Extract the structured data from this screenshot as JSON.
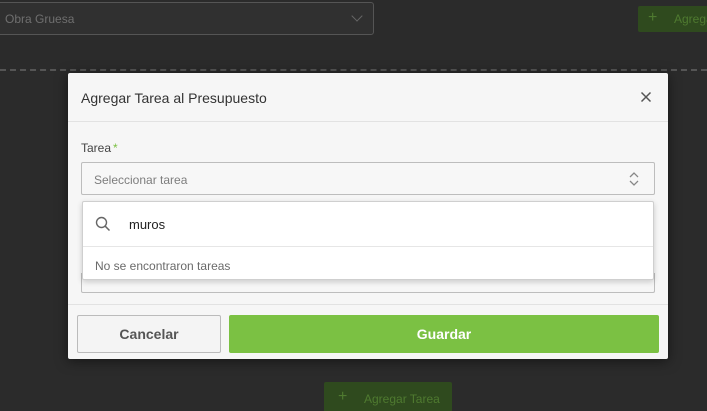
{
  "background": {
    "stage_select": {
      "value": "Obra Gruesa"
    },
    "add_top_button": {
      "label": "Agregar Tarea"
    },
    "add_bottom_button": {
      "label": "Agregar Tarea"
    }
  },
  "modal": {
    "title": "Agregar Tarea al Presupuesto",
    "field": {
      "label": "Tarea",
      "required_mark": "*",
      "placeholder": "Seleccionar tarea"
    },
    "dropdown": {
      "search_value": "muros",
      "empty_message": "No se encontraron tareas"
    },
    "footer": {
      "cancel_label": "Cancelar",
      "save_label": "Guardar"
    }
  },
  "colors": {
    "accent": "#7bc143",
    "overlay": "#2b2b2b"
  }
}
